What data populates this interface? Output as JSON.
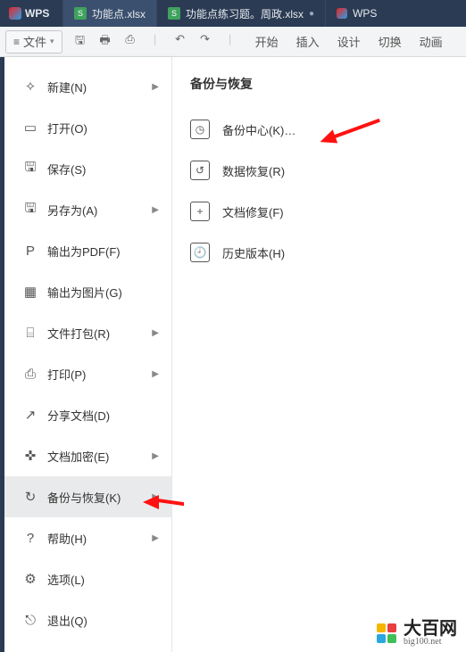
{
  "titlebar": {
    "app": "WPS",
    "tabs": [
      {
        "label": "功能点.xlsx",
        "icon": "S"
      },
      {
        "label": "功能点练习题。周政.xlsx",
        "icon": "S"
      },
      {
        "label": "WPS",
        "icon": "wps"
      }
    ]
  },
  "toolbar": {
    "file_label": "文件",
    "tabs": {
      "start": "开始",
      "insert": "插入",
      "design": "设计",
      "switch": "切换",
      "animation": "动画"
    }
  },
  "file_menu": [
    {
      "key": "new",
      "label": "新建(N)",
      "icon": "✧",
      "arrow": true
    },
    {
      "key": "open",
      "label": "打开(O)",
      "icon": "▭",
      "arrow": false
    },
    {
      "key": "save",
      "label": "保存(S)",
      "icon": "🖫",
      "arrow": false
    },
    {
      "key": "saveas",
      "label": "另存为(A)",
      "icon": "🖫",
      "arrow": true
    },
    {
      "key": "pdf",
      "label": "输出为PDF(F)",
      "icon": "P",
      "arrow": false
    },
    {
      "key": "image",
      "label": "输出为图片(G)",
      "icon": "▦",
      "arrow": false
    },
    {
      "key": "pack",
      "label": "文件打包(R)",
      "icon": "⌸",
      "arrow": true
    },
    {
      "key": "print",
      "label": "打印(P)",
      "icon": "⎙",
      "arrow": true
    },
    {
      "key": "share",
      "label": "分享文档(D)",
      "icon": "↗",
      "arrow": false
    },
    {
      "key": "encrypt",
      "label": "文档加密(E)",
      "icon": "✜",
      "arrow": true
    },
    {
      "key": "backup",
      "label": "备份与恢复(K)",
      "icon": "↻",
      "arrow": true,
      "selected": true
    },
    {
      "key": "help",
      "label": "帮助(H)",
      "icon": "?",
      "arrow": true
    },
    {
      "key": "options",
      "label": "选项(L)",
      "icon": "⚙",
      "arrow": false
    },
    {
      "key": "exit",
      "label": "退出(Q)",
      "icon": "⎋",
      "arrow": false
    }
  ],
  "sub_panel": {
    "title": "备份与恢复",
    "items": [
      {
        "key": "center",
        "label": "备份中心(K)…",
        "icon": "◷"
      },
      {
        "key": "recover",
        "label": "数据恢复(R)",
        "icon": "↺"
      },
      {
        "key": "repair",
        "label": "文档修复(F)",
        "icon": "+"
      },
      {
        "key": "history",
        "label": "历史版本(H)",
        "icon": "🕘"
      }
    ]
  },
  "watermark": {
    "name": "大百网",
    "url": "big100.net"
  }
}
